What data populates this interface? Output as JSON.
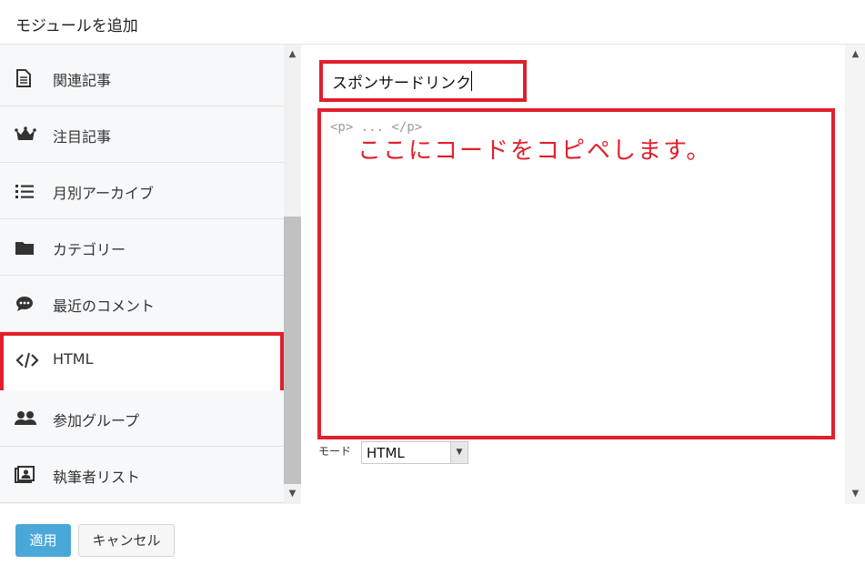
{
  "dialog": {
    "title": "モジュールを追加"
  },
  "sidebar": {
    "items": [
      {
        "label": "関連記事",
        "icon": "document-icon"
      },
      {
        "label": "注目記事",
        "icon": "crown-icon"
      },
      {
        "label": "月別アーカイブ",
        "icon": "list-icon"
      },
      {
        "label": "カテゴリー",
        "icon": "folder-icon"
      },
      {
        "label": "最近のコメント",
        "icon": "comment-icon"
      },
      {
        "label": "HTML",
        "icon": "code-icon",
        "selected": true
      },
      {
        "label": "参加グループ",
        "icon": "group-icon"
      },
      {
        "label": "執筆者リスト",
        "icon": "author-list-icon"
      }
    ]
  },
  "editor": {
    "title_value": "スポンサードリンク",
    "code_placeholder": "<p> ... </p>",
    "code_note": "ここにコードをコピペします。",
    "mode_label": "モード",
    "mode_value": "HTML"
  },
  "footer": {
    "apply_label": "適用",
    "cancel_label": "キャンセル"
  },
  "colors": {
    "highlight": "#e0202c",
    "apply": "#4aa8d8"
  }
}
